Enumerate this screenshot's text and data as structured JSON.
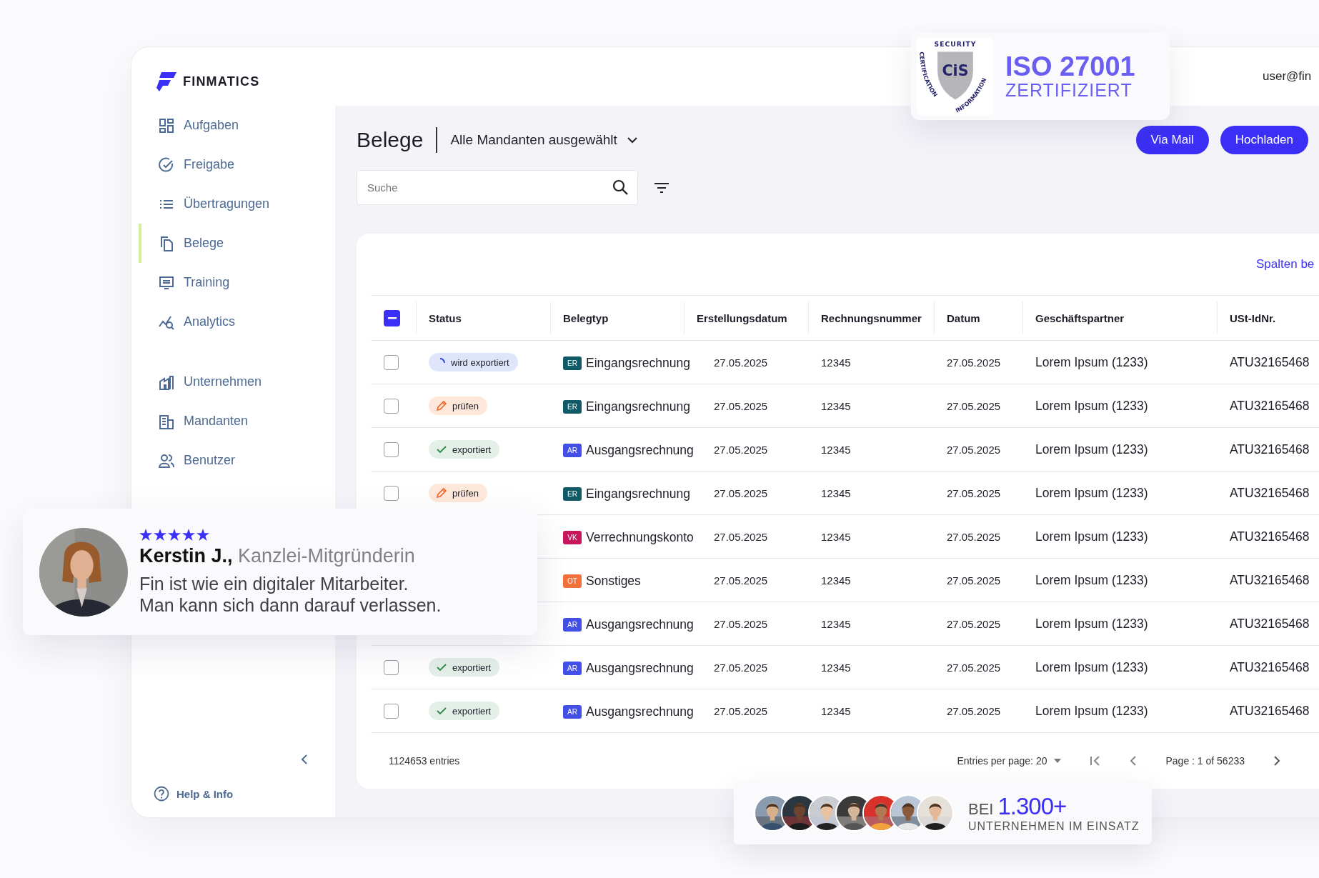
{
  "sidebar": {
    "brand": "FINMATICS",
    "nav_main": [
      {
        "label": "Aufgaben",
        "selected": false
      },
      {
        "label": "Freigabe",
        "selected": false
      },
      {
        "label": "Übertragungen",
        "selected": false
      },
      {
        "label": "Belege",
        "selected": true
      },
      {
        "label": "Training",
        "selected": false
      },
      {
        "label": "Analytics",
        "selected": false
      }
    ],
    "nav_secondary": [
      {
        "label": "Unternehmen",
        "selected": false
      },
      {
        "label": "Mandanten",
        "selected": false
      },
      {
        "label": "Benutzer",
        "selected": false
      }
    ],
    "help": "Help & Info"
  },
  "top_bar": {
    "user": "user@fin"
  },
  "header": {
    "title": "Belege",
    "client_select": "Alle Mandanten ausgewählt",
    "buttons": [
      "Via Mail",
      "Hochladen"
    ]
  },
  "search": {
    "placeholder": "Suche"
  },
  "table": {
    "columns_link": "Spalten be",
    "select_all": {
      "partial": true
    },
    "columns": [
      "Status",
      "Belegtyp",
      "Erstellungsdatum",
      "Rechnungsnummer",
      "Datum",
      "Geschäftspartner",
      "USt-IdNr."
    ],
    "rows": [
      {
        "checked": false,
        "status": {
          "kind": "exporting",
          "label": "wird exportiert"
        },
        "type": {
          "code": "ER",
          "color": "#0f5a66",
          "label": "Eingangsrechnung"
        },
        "created": "27.05.2025",
        "number": "12345",
        "date": "27.05.2025",
        "partner": "Lorem Ipsum (1233)",
        "vat": "ATU32165468"
      },
      {
        "checked": false,
        "status": {
          "kind": "review",
          "label": "prüfen"
        },
        "type": {
          "code": "ER",
          "color": "#0f5a66",
          "label": "Eingangsrechnung"
        },
        "created": "27.05.2025",
        "number": "12345",
        "date": "27.05.2025",
        "partner": "Lorem Ipsum (1233)",
        "vat": "ATU32165468"
      },
      {
        "checked": false,
        "status": {
          "kind": "exported",
          "label": "exportiert"
        },
        "type": {
          "code": "AR",
          "color": "#4350e8",
          "label": "Ausgangsrechnung"
        },
        "created": "27.05.2025",
        "number": "12345",
        "date": "27.05.2025",
        "partner": "Lorem Ipsum (1233)",
        "vat": "ATU32165468"
      },
      {
        "checked": false,
        "status": {
          "kind": "review",
          "label": "prüfen"
        },
        "type": {
          "code": "ER",
          "color": "#0f5a66",
          "label": "Eingangsrechnung"
        },
        "created": "27.05.2025",
        "number": "12345",
        "date": "27.05.2025",
        "partner": "Lorem Ipsum (1233)",
        "vat": "ATU32165468"
      },
      {
        "type": {
          "code": "VK",
          "color": "#c8175d",
          "label": "Verrechnungskonto"
        },
        "created": "27.05.2025",
        "number": "12345",
        "date": "27.05.2025",
        "partner": "Lorem Ipsum (1233)",
        "vat": "ATU32165468"
      },
      {
        "type": {
          "code": "OT",
          "color": "#f5703a",
          "label": "Sonstiges"
        },
        "created": "27.05.2025",
        "number": "12345",
        "date": "27.05.2025",
        "partner": "Lorem Ipsum (1233)",
        "vat": "ATU32165468"
      },
      {
        "type": {
          "code": "AR",
          "color": "#4350e8",
          "label": "Ausgangsrechnung"
        },
        "created": "27.05.2025",
        "number": "12345",
        "date": "27.05.2025",
        "partner": "Lorem Ipsum (1233)",
        "vat": "ATU32165468"
      },
      {
        "checked": false,
        "status": {
          "kind": "exported",
          "label": "exportiert"
        },
        "type": {
          "code": "AR",
          "color": "#4350e8",
          "label": "Ausgangsrechnung"
        },
        "created": "27.05.2025",
        "number": "12345",
        "date": "27.05.2025",
        "partner": "Lorem Ipsum (1233)",
        "vat": "ATU32165468"
      },
      {
        "checked": false,
        "status": {
          "kind": "exported",
          "label": "exportiert"
        },
        "type": {
          "code": "AR",
          "color": "#4350e8",
          "label": "Ausgangsrechnung"
        },
        "created": "27.05.2025",
        "number": "12345",
        "date": "27.05.2025",
        "partner": "Lorem Ipsum (1233)",
        "vat": "ATU32165468"
      }
    ],
    "footer": {
      "total": "1124653 entries",
      "per_page": "Entries per page: 20",
      "page": "Page : 1 of 56233"
    }
  },
  "certificate": {
    "logo_top": "SECURITY",
    "logo_mark": "CiS",
    "logo_left": "CERTIFICATION",
    "logo_right": "INFORMATION",
    "title": "ISO 27001",
    "subtitle": "ZERTIFIZIERT"
  },
  "testimonial": {
    "stars": 5,
    "name": "Kerstin J.,",
    "role": "Kanzlei-Mitgründerin",
    "quote": [
      "Fin ist wie ein digitaler Mitarbeiter.",
      "Man kann sich dann darauf verlassen."
    ]
  },
  "social_proof": {
    "prefix": "BEI",
    "count": "1.300+",
    "caption": "UNTERNEHMEN IM EINSATZ"
  }
}
